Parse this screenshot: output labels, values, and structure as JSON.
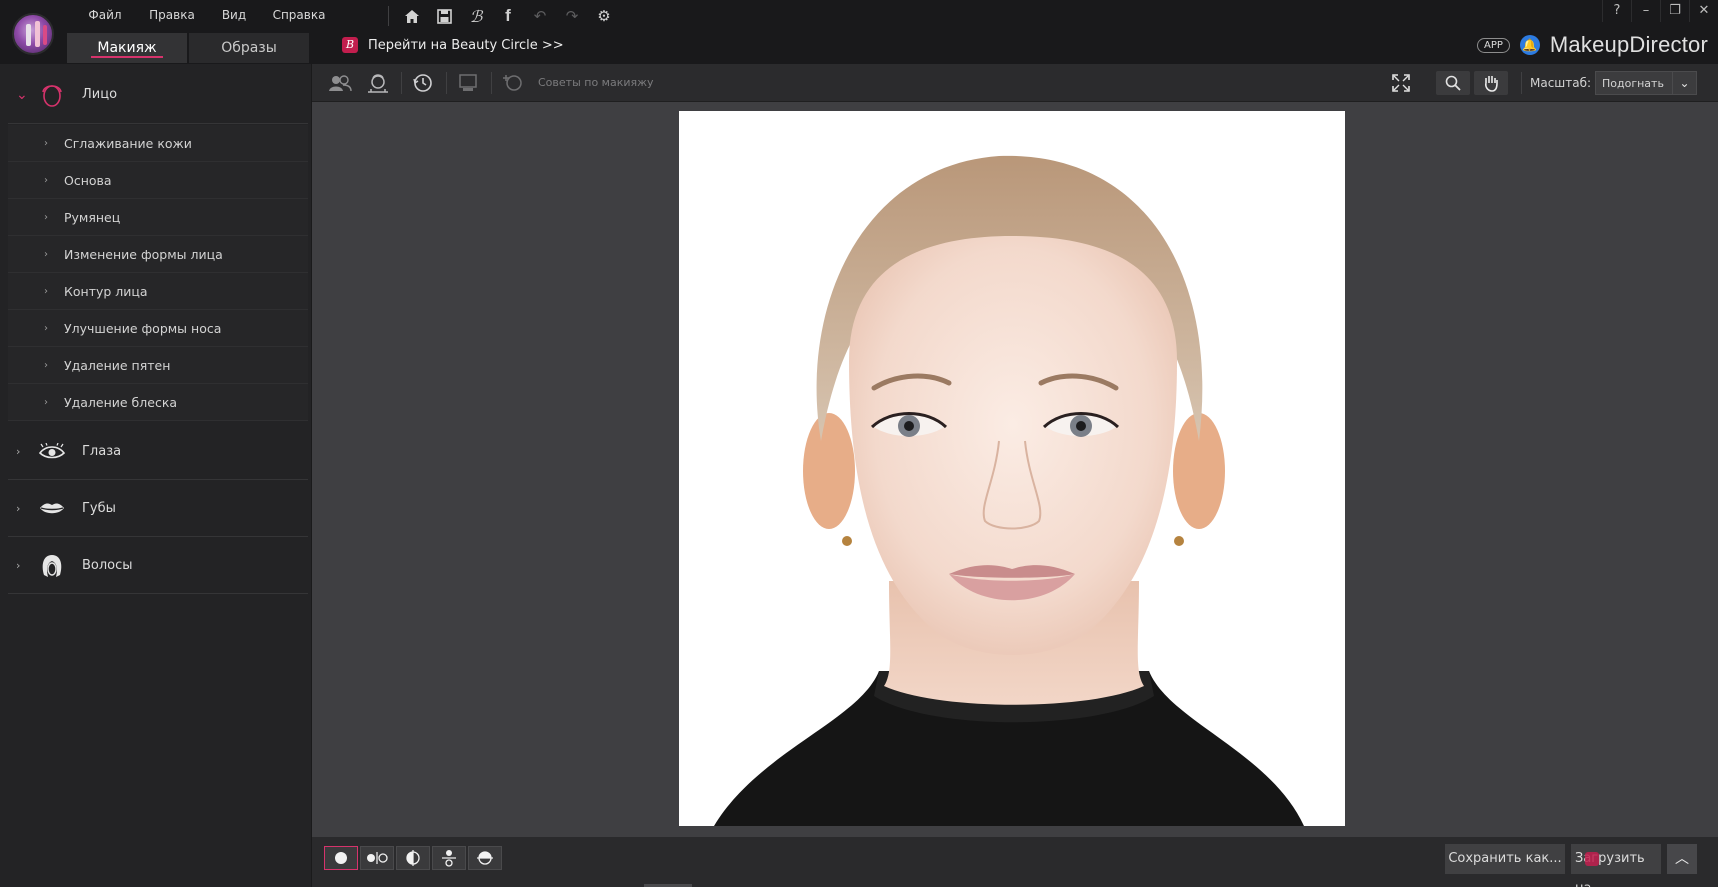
{
  "app": {
    "brand_prefix": "Makeup",
    "brand_suffix": "Director",
    "app_badge": "APP",
    "accent_color": "#d6336c"
  },
  "menu": {
    "file": "Файл",
    "edit": "Правка",
    "view": "Вид",
    "help": "Справка"
  },
  "quick_tools": [
    "home-icon",
    "save-icon",
    "beauty-circle-icon",
    "facebook-icon",
    "undo-icon",
    "redo-icon",
    "settings-icon"
  ],
  "tabs": [
    {
      "label": "Макияж",
      "active": true
    },
    {
      "label": "Образы",
      "active": false
    }
  ],
  "beauty_circle_link": "Перейти на Beauty Circle >>",
  "window_controls": {
    "help": "?",
    "minimize": "–",
    "restore": "❐",
    "close": "✕"
  },
  "sidebar": {
    "categories": [
      {
        "label": "Лицо",
        "expanded": true,
        "icon": "face-icon",
        "items": [
          "Сглаживание кожи",
          "Основа",
          "Румянец",
          "Изменение формы лица",
          "Контур лица",
          "Улучшение формы носа",
          "Удаление пятен",
          "Удаление блеска"
        ]
      },
      {
        "label": "Глаза",
        "expanded": false,
        "icon": "eye-icon"
      },
      {
        "label": "Губы",
        "expanded": false,
        "icon": "lips-icon"
      },
      {
        "label": "Волосы",
        "expanded": false,
        "icon": "hair-icon"
      }
    ]
  },
  "toolbar": {
    "tips_label": "Советы по макияжу",
    "scale_label": "Масштаб:",
    "scale_value": "Подогнать"
  },
  "bottom": {
    "save_label": "Сохранить как...",
    "share_label": "Загрузить на..."
  }
}
